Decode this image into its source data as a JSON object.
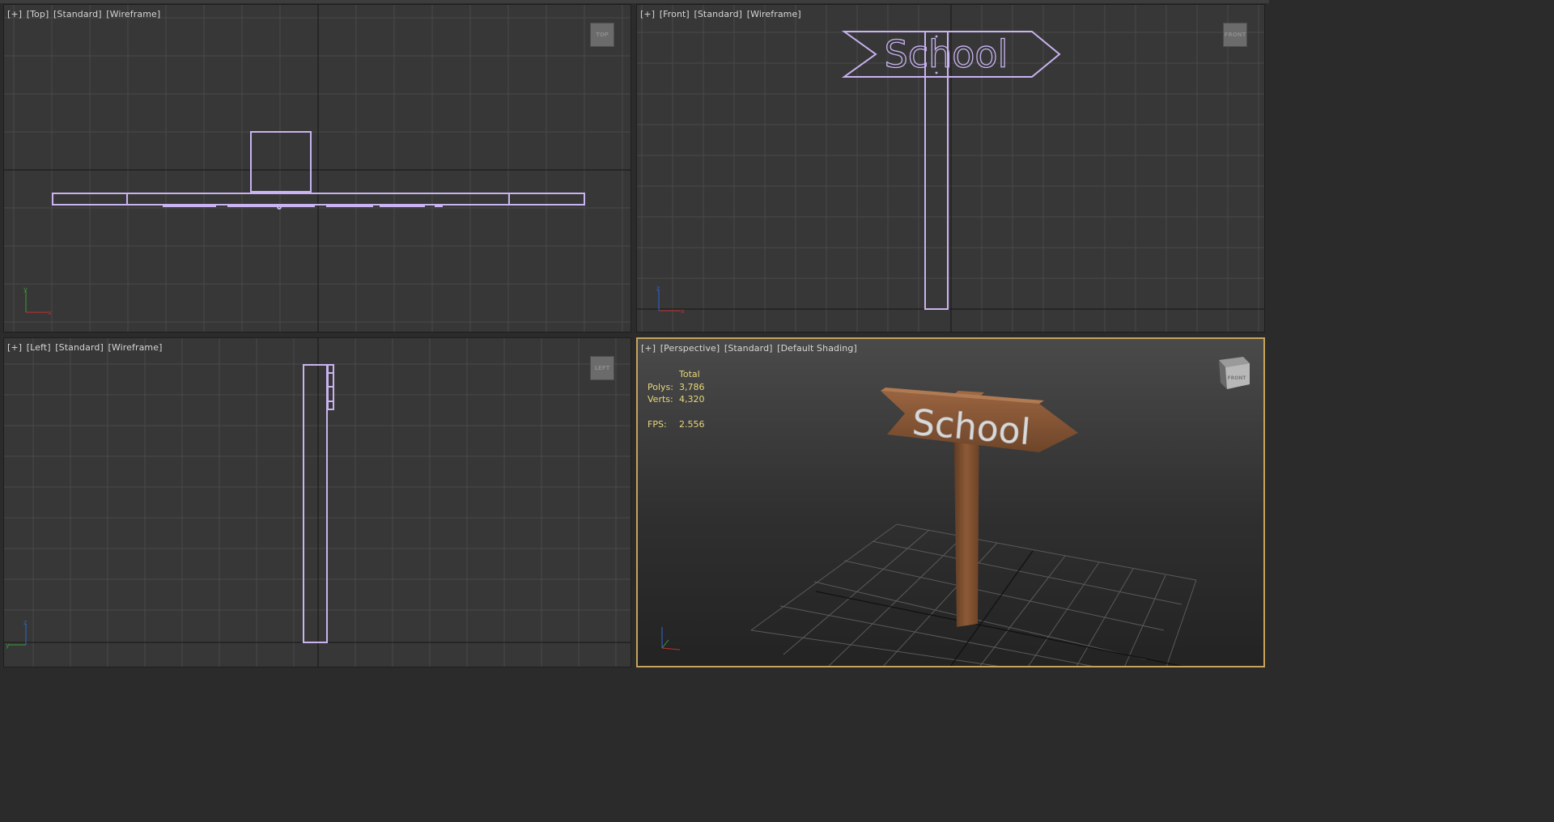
{
  "viewports": {
    "top": {
      "label": [
        "[+]",
        "[Top]",
        "[Standard]",
        "[Wireframe]"
      ],
      "cube_label": "TOP",
      "axis": {
        "v": "y",
        "h": "x"
      }
    },
    "front": {
      "label": [
        "[+]",
        "[Front]",
        "[Standard]",
        "[Wireframe]"
      ],
      "cube_label": "FRONT",
      "sign_text": "School",
      "axis": {
        "v": "z",
        "h": "x"
      }
    },
    "left": {
      "label": [
        "[+]",
        "[Left]",
        "[Standard]",
        "[Wireframe]"
      ],
      "cube_label": "LEFT",
      "axis": {
        "v": "z",
        "h": "y"
      }
    },
    "perspective": {
      "label": [
        "[+]",
        "[Perspective]",
        "[Standard]",
        "[Default Shading]"
      ],
      "cube_label": "FRONT",
      "sign_text": "School",
      "stats": {
        "header": "Total",
        "polys_label": "Polys:",
        "polys_value": "3,786",
        "verts_label": "Verts:",
        "verts_value": "4,320",
        "fps_label": "FPS:",
        "fps_value": "2.556"
      }
    }
  },
  "colors": {
    "viewport_bg": "#373737",
    "grid": "#4a4a4a",
    "wireframe": "#c9b3f0",
    "active_border": "#c8a35a",
    "stats_text": "#e8d87a",
    "wood": "#8a5634"
  }
}
